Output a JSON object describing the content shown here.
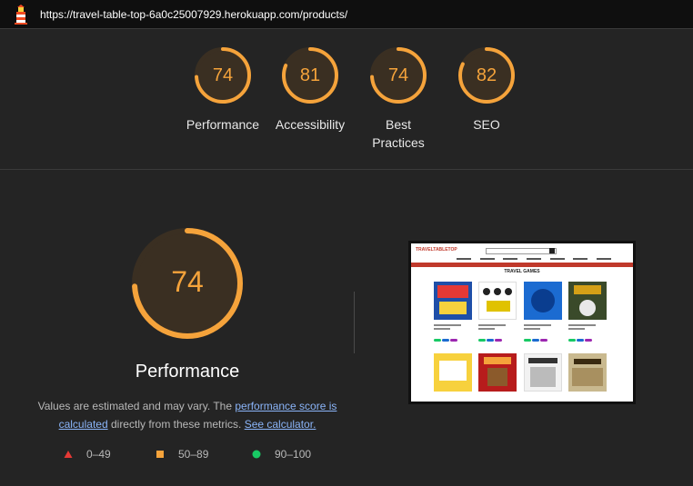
{
  "header": {
    "url": "https://travel-table-top-6a0c25007929.herokuapp.com/products/"
  },
  "gauges": [
    {
      "score": "74",
      "label": "Performance",
      "fraction": 0.74
    },
    {
      "score": "81",
      "label": "Accessibility",
      "fraction": 0.81
    },
    {
      "score": "74",
      "label": "Best Practices",
      "fraction": 0.74
    },
    {
      "score": "82",
      "label": "SEO",
      "fraction": 0.82
    }
  ],
  "performance": {
    "score": "74",
    "fraction": 0.74,
    "title": "Performance",
    "desc_part1": "Values are estimated and may vary. The ",
    "link_score": "performance score is calculated",
    "desc_part2": " directly from these metrics. ",
    "link_calc": "See calculator."
  },
  "legend": [
    {
      "range": "0–49",
      "shape": "triangle",
      "color": "#e53935"
    },
    {
      "range": "50–89",
      "shape": "square",
      "color": "#f5a33b"
    },
    {
      "range": "90–100",
      "shape": "circle",
      "color": "#18c964"
    }
  ],
  "colors": {
    "average": "#f5a33b",
    "gauge_track": "#3a2f22",
    "background": "#242424"
  },
  "screenshot": {
    "logo": "TRAVELTABLETOP",
    "heading": "TRAVEL GAMES"
  }
}
